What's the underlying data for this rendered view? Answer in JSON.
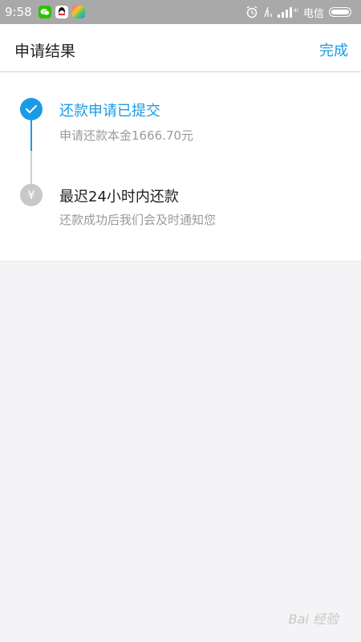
{
  "status_bar": {
    "time": "9:58",
    "carrier": "电信",
    "icons": [
      "wechat-icon",
      "qq-icon",
      "photos-icon",
      "alarm-icon",
      "no-sim-icon",
      "signal-icon",
      "battery-icon"
    ],
    "network_label": "4G"
  },
  "nav": {
    "title": "申请结果",
    "done_label": "完成"
  },
  "steps": [
    {
      "title": "还款申请已提交",
      "subtitle": "申请还款本金1666.70元",
      "state": "done",
      "icon": "checkmark-icon",
      "color": "#1a9be6"
    },
    {
      "title": "最迟24小时内还款",
      "subtitle": "还款成功后我们会及时通知您",
      "state": "pending",
      "icon": "yuan-icon",
      "icon_glyph": "¥",
      "color": "#c8c8c8"
    }
  ],
  "watermark": {
    "text": "Bai 经验"
  },
  "colors": {
    "accent": "#1a9be6",
    "status_bar": "#a9a9a9",
    "background": "#f4f4f6"
  }
}
